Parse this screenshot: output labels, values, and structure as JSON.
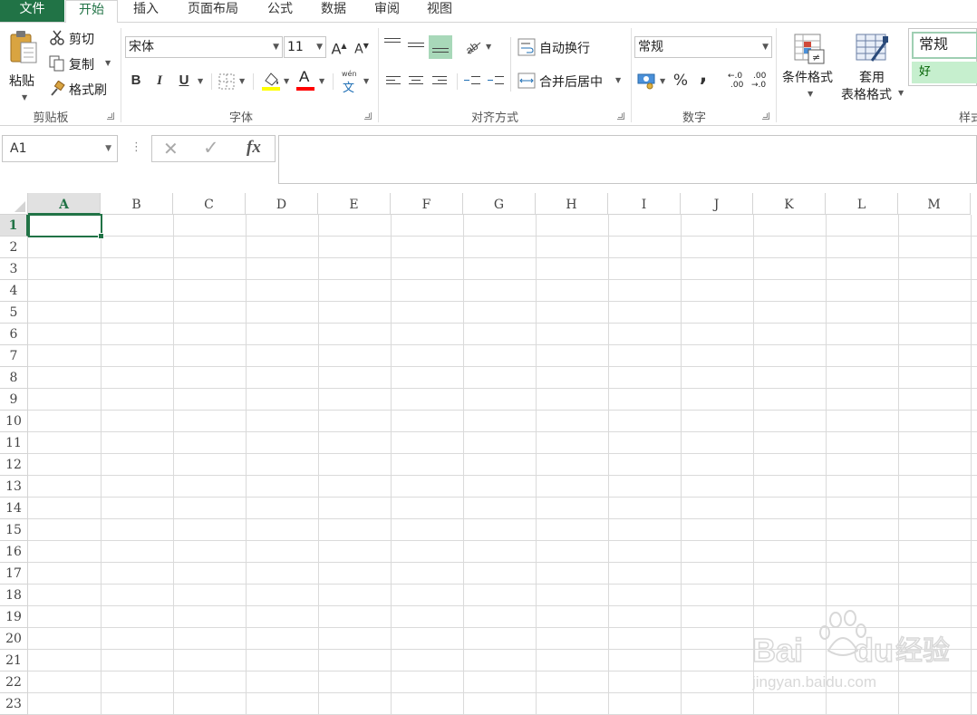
{
  "tabs": [
    {
      "label": "文件",
      "name": "tab-file"
    },
    {
      "label": "开始",
      "name": "tab-home"
    },
    {
      "label": "插入",
      "name": "tab-insert"
    },
    {
      "label": "页面布局",
      "name": "tab-page-layout"
    },
    {
      "label": "公式",
      "name": "tab-formulas"
    },
    {
      "label": "数据",
      "name": "tab-data"
    },
    {
      "label": "审阅",
      "name": "tab-review"
    },
    {
      "label": "视图",
      "name": "tab-view"
    }
  ],
  "clipboard": {
    "paste": "粘贴",
    "cut": "剪切",
    "copy": "复制",
    "format_painter": "格式刷",
    "group": "剪贴板"
  },
  "font": {
    "name": "宋体",
    "size": "11",
    "bold": "B",
    "italic": "I",
    "underline": "U",
    "grow": "A",
    "shrink": "A",
    "phonetic_top": "wén",
    "phonetic_bottom": "文",
    "font_color_glyph": "A",
    "group": "字体",
    "highlight_color": "#ffff00",
    "font_color": "#ff0000"
  },
  "alignment": {
    "wrap_text": "自动换行",
    "merge_center": "合并后居中",
    "group": "对齐方式"
  },
  "number": {
    "format": "常规",
    "percent": "%",
    "comma": ",",
    "inc_top": "←.0",
    "inc_bottom": ".00",
    "dec_top": ".00",
    "dec_bottom": "→.0",
    "group": "数字"
  },
  "styles": {
    "conditional_format": "条件格式",
    "format_table_line1": "套用",
    "format_table_line2": "表格格式",
    "style_normal": "常规",
    "style_good": "好",
    "group": "样式"
  },
  "formula_bar": {
    "name_box": "A1",
    "cancel": "✕",
    "enter": "✓",
    "fx": "fx",
    "more": "⋮",
    "value": ""
  },
  "grid": {
    "columns": [
      "A",
      "B",
      "C",
      "D",
      "E",
      "F",
      "G",
      "H",
      "I",
      "J",
      "K",
      "L",
      "M"
    ],
    "rows": [
      "1",
      "2",
      "3",
      "4",
      "5",
      "6",
      "7",
      "8",
      "9",
      "10",
      "11",
      "12",
      "13",
      "14",
      "15",
      "16",
      "17",
      "18",
      "19",
      "20",
      "21",
      "22",
      "23"
    ],
    "selected_column": "A",
    "selected_row": "1",
    "accent": "#217346"
  },
  "watermark": {
    "brand": "Bai",
    "brand2": "du",
    "cn": "经验",
    "url": "jingyan.baidu.com"
  }
}
